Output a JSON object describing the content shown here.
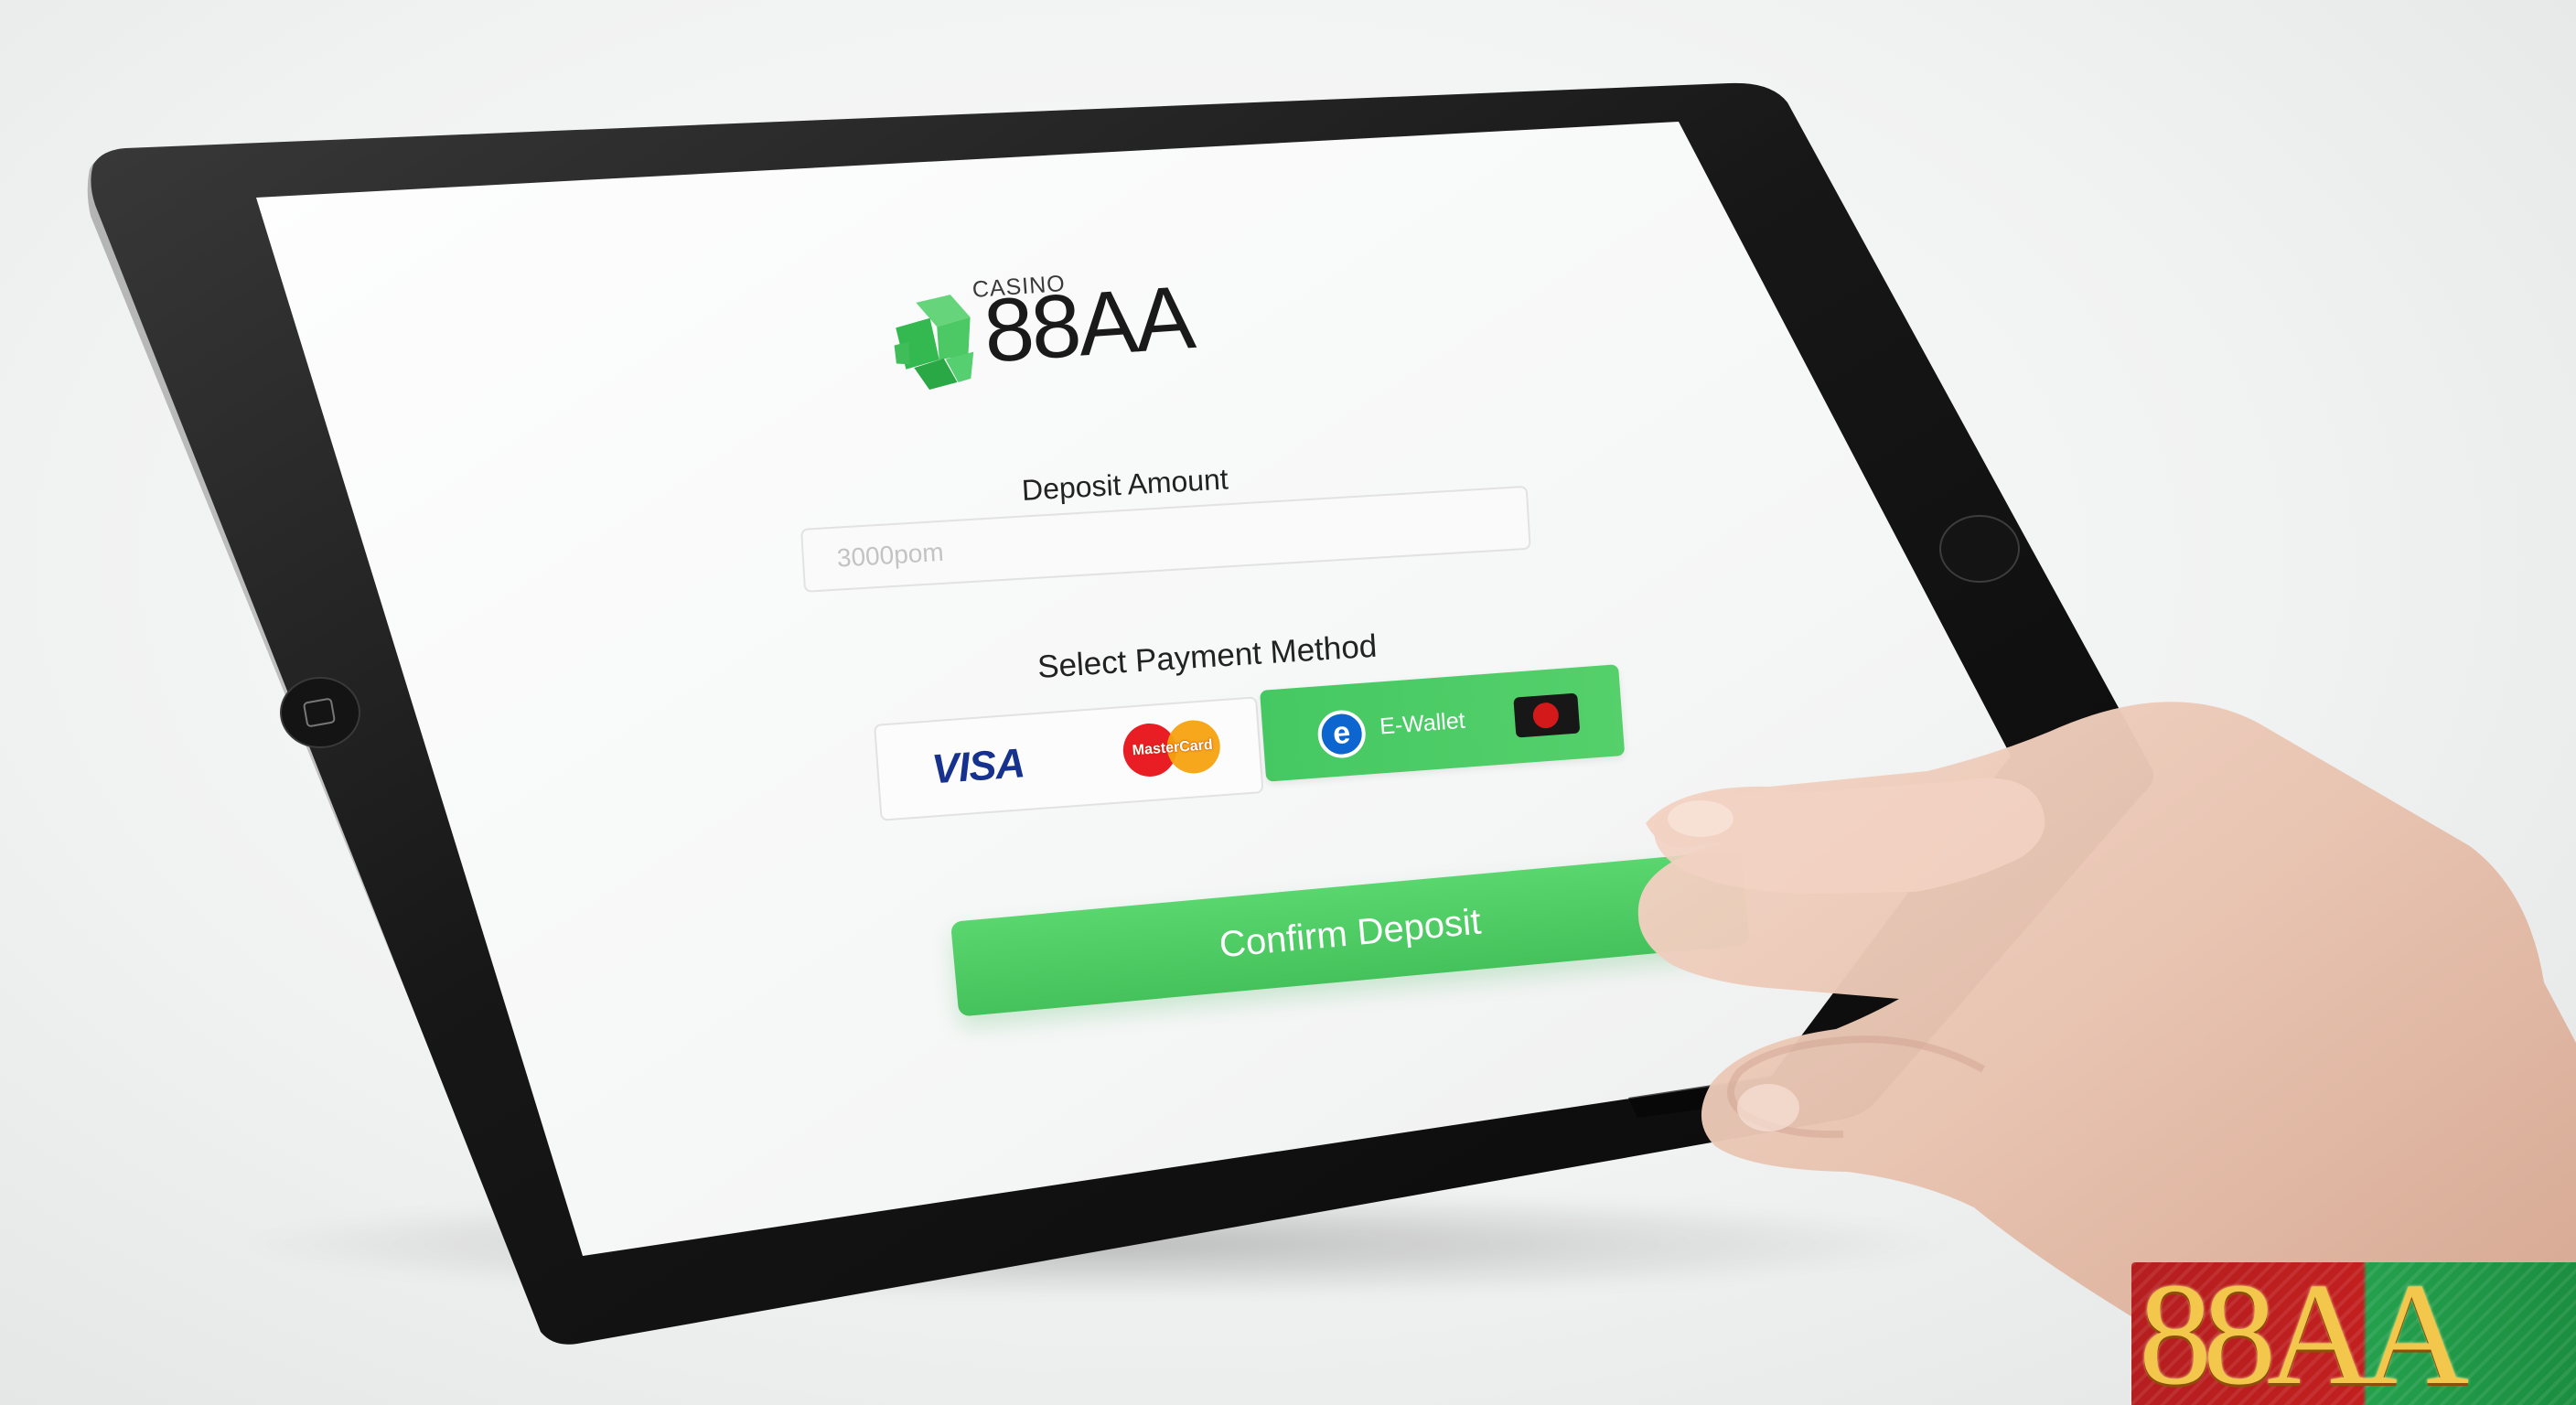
{
  "app": {
    "brand_small": "CASINO",
    "brand_name": "88AA"
  },
  "deposit": {
    "label": "Deposit Amount",
    "placeholder": "3000pom"
  },
  "payment": {
    "label": "Select Payment Method",
    "options": [
      {
        "label": "VISA",
        "type": "card"
      },
      {
        "label": "MasterCard",
        "type": "card"
      },
      {
        "label": "E-Wallet",
        "type": "wallet"
      }
    ]
  },
  "actions": {
    "confirm_label": "Confirm Deposit"
  },
  "watermark": {
    "text": "88AA"
  },
  "colors": {
    "accent_green": "#4fcf68",
    "visa_blue": "#17328e",
    "ewallet_blue": "#0d66d0"
  },
  "icons": {
    "brand": "cube-logo-icon",
    "wallet": "ewallet-icon",
    "chip": "card-chip-icon"
  }
}
